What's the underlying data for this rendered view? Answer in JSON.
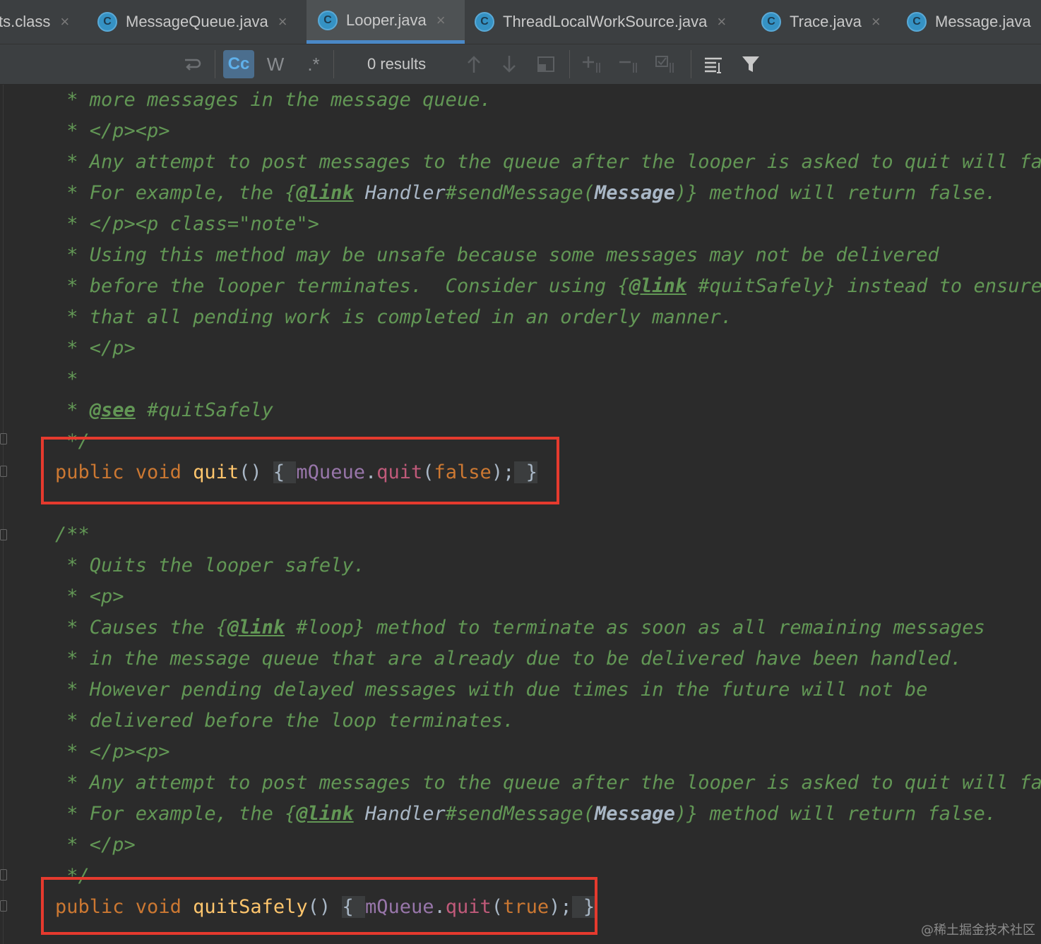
{
  "tabs": [
    {
      "label": "ts.class",
      "icon": "class-icon",
      "active": false
    },
    {
      "label": "MessageQueue.java",
      "icon": "class-icon",
      "active": false
    },
    {
      "label": "Looper.java",
      "icon": "class-icon",
      "active": true
    },
    {
      "label": "ThreadLocalWorkSource.java",
      "icon": "class-icon",
      "active": false
    },
    {
      "label": "Trace.java",
      "icon": "class-icon",
      "active": false
    },
    {
      "label": "Message.java",
      "icon": "class-icon",
      "active": false
    }
  ],
  "icon_glyph": "C",
  "close_glyph": "×",
  "find_toolbar": {
    "match_case": "Cc",
    "words": "W",
    "regex": ".*",
    "results": "0 results"
  },
  "code": {
    "l1": " * more messages in the message queue.",
    "l2": " * </p><p>",
    "l3": " * Any attempt to post messages to the queue after the looper is asked to quit will fail.",
    "l4a": " * For example, the {",
    "l4b": "@link",
    "l4c": " Handler",
    "l4d": "#sendMessage(",
    "l4e": "Message",
    "l4f": ")} method will return false.",
    "l5": " * </p><p class=\"note\">",
    "l6": " * Using this method may be unsafe because some messages may not be delivered",
    "l7a": " * before the looper terminates.  Consider using {",
    "l7b": "@link",
    "l7c": " #quitSafely} instead to ensure",
    "l8": " * that all pending work is completed in an orderly manner.",
    "l9": " * </p>",
    "l10": " *",
    "l11a": " * ",
    "l11b": "@see",
    "l11c": " #quitSafely",
    "l12": " */",
    "q_public": "public",
    "q_void": " void ",
    "q_name": "quit",
    "q_parens": "() ",
    "q_open": "{ ",
    "q_field": "mQueue",
    "q_dot": ".",
    "q_call": "quit",
    "q_arg_open": "(",
    "q_arg": "false",
    "q_arg_close": ");",
    "q_close": " }",
    "d_open": "/**",
    "d1": " * Quits the looper safely.",
    "d2": " * <p>",
    "d3a": " * Causes the {",
    "d3b": "@link",
    "d3c": " #loop} method to terminate as soon as all remaining messages",
    "d4": " * in the message queue that are already due to be delivered have been handled.",
    "d5": " * However pending delayed messages with due times in the future will not be",
    "d6": " * delivered before the loop terminates.",
    "d7": " * </p><p>",
    "d8": " * Any attempt to post messages to the queue after the looper is asked to quit will fail.",
    "d9a": " * For example, the {",
    "d9b": "@link",
    "d9c": " Handler",
    "d9d": "#sendMessage(",
    "d9e": "Message",
    "d9f": ")} method will return false.",
    "d10": " * </p>",
    "d11": " */",
    "s_public": "public",
    "s_void": " void ",
    "s_name": "quitSafely",
    "s_parens": "() ",
    "s_open": "{ ",
    "s_field": "mQueue",
    "s_dot": ".",
    "s_call": "quit",
    "s_arg_open": "(",
    "s_arg": "true",
    "s_arg_close": ");",
    "s_close": " }"
  },
  "watermark": "@稀土掘金技术社区",
  "colors": {
    "background": "#2b2b2b",
    "doc_comment": "#629755",
    "keyword": "#cc7832",
    "method": "#ffc66d",
    "field": "#9876aa",
    "highlight_box": "#e53a2e"
  }
}
